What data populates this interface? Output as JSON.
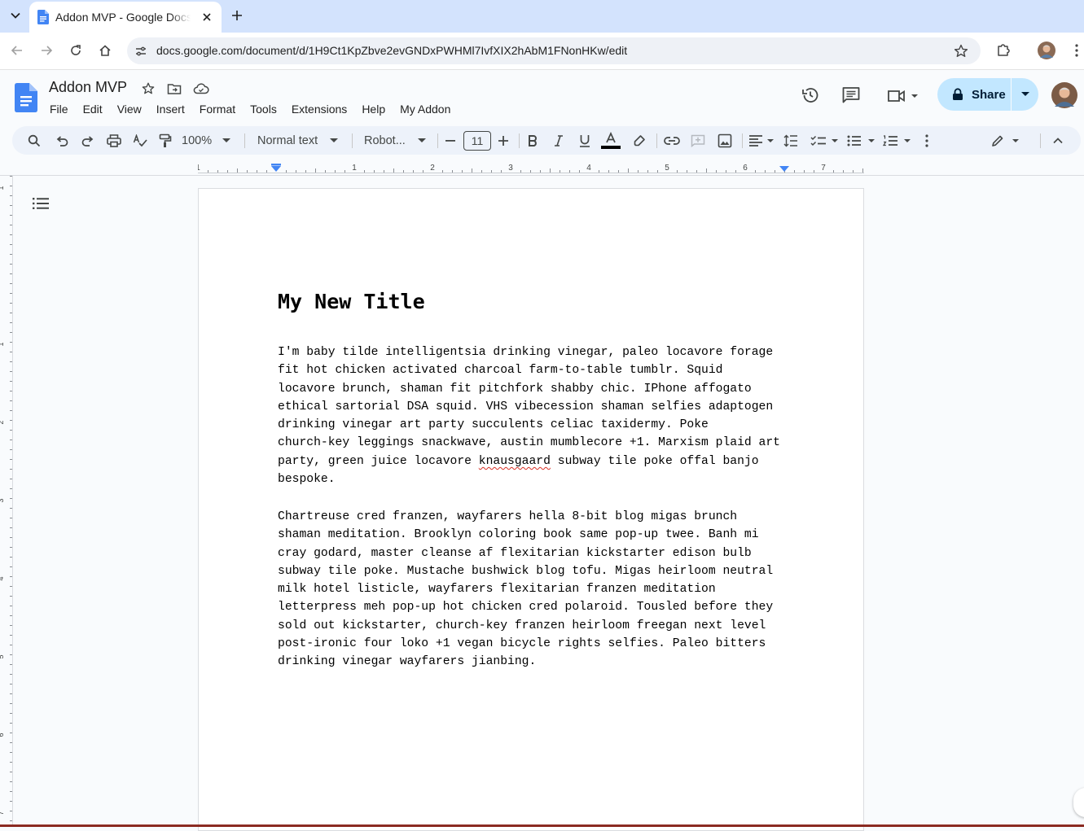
{
  "browser": {
    "tab_title": "Addon MVP - Google Docs",
    "url": "docs.google.com/document/d/1H9Ct1KpZbve2evGNDxPWHMl7IvfXIX2hAbM1FNonHKw/edit"
  },
  "docs": {
    "title": "Addon MVP",
    "menu": [
      "File",
      "Edit",
      "View",
      "Insert",
      "Format",
      "Tools",
      "Extensions",
      "Help",
      "My Addon"
    ],
    "share_label": "Share"
  },
  "toolbar": {
    "zoom": "100%",
    "style": "Normal text",
    "font": "Robot...",
    "font_size": "11"
  },
  "ruler": {
    "marks": [
      "1",
      "1",
      "2",
      "3",
      "4",
      "5",
      "6",
      "7"
    ],
    "vmarks": [
      "1",
      "1",
      "2",
      "3",
      "4",
      "5",
      "6",
      "7"
    ]
  },
  "document": {
    "heading": "My New Title",
    "paragraph1": [
      "I'm baby tilde intelligentsia drinking vinegar, paleo locavore forage",
      "fit hot chicken activated charcoal farm-to-table tumblr. Squid",
      "locavore brunch, shaman fit pitchfork shabby chic. IPhone affogato",
      "ethical sartorial DSA squid. VHS vibecession shaman selfies adaptogen",
      "drinking vinegar art party succulents celiac taxidermy. Poke",
      "church-key leggings snackwave, austin mumblecore +1. Marxism plaid art",
      "party, green juice locavore ",
      "bespoke."
    ],
    "p1_line7_misspelled": "knausgaard",
    "p1_line7_rest": " subway tile poke offal banjo",
    "paragraph2": [
      "Chartreuse cred franzen, wayfarers hella 8-bit blog migas brunch",
      "shaman meditation. Brooklyn coloring book same pop-up twee. Banh mi",
      "cray godard, master cleanse af flexitarian kickstarter edison bulb",
      "subway tile poke. Mustache bushwick blog tofu. Migas heirloom neutral",
      "milk hotel listicle, wayfarers flexitarian franzen meditation",
      "letterpress meh pop-up hot chicken cred polaroid. Tousled before they",
      "sold out kickstarter, church-key franzen heirloom freegan next level",
      "post-ironic four loko +1 vegan bicycle rights selfies. Paleo bitters",
      "drinking vinegar wayfarers jianbing."
    ]
  },
  "colors": {
    "accent": "#0b57d0",
    "share_bg": "#c2e7ff",
    "toolbar_bg": "#edf2fa",
    "tabstrip_bg": "#d3e3fd"
  }
}
